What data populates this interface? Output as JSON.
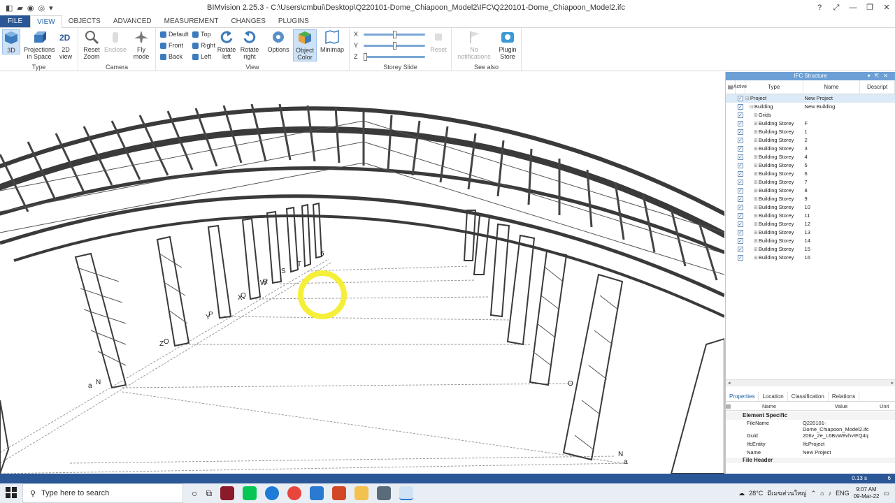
{
  "window": {
    "title": "BIMvision 2.25.3 - C:\\Users\\cmbui\\Desktop\\Q220101-Dome_Chiapoon_Model2\\IFC\\Q220101-Dome_Chiapoon_Model2.ifc",
    "help": "?"
  },
  "tabs": [
    "FILE",
    "VIEW",
    "OBJECTS",
    "ADVANCED",
    "MEASUREMENT",
    "CHANGES",
    "PLUGINS"
  ],
  "ribbon": {
    "type_group": {
      "label": "Type",
      "btn_3d": "3D",
      "btn_proj": "Projections in Space",
      "btn_2d": "2D view"
    },
    "camera_group": {
      "label": "Camera",
      "reset_zoom": "Reset Zoom",
      "enclose": "Enclose",
      "fly_mode": "Fly mode"
    },
    "view_group": {
      "label": "View",
      "default": "Default",
      "top": "Top",
      "front": "Front",
      "right": "Right",
      "back": "Back",
      "left": "Left",
      "rotate_left": "Rotate left",
      "rotate_right": "Rotate right",
      "options": "Options",
      "object_color": "Object Color",
      "minimap": "Minimap"
    },
    "storey_group": {
      "label": "Storey Slide",
      "x": "X",
      "y": "Y",
      "z": "Z",
      "reset": "Reset"
    },
    "see_also_group": {
      "label": "See also",
      "notifications": "No notifications",
      "plugin_store": "Plugin Store"
    }
  },
  "viewport": {
    "labels": [
      "6",
      "T",
      "S",
      "R",
      "Q",
      "P",
      "O",
      "N",
      "O",
      "N",
      "a",
      "Z",
      "Y",
      "X",
      "W",
      "a"
    ]
  },
  "ifc_structure": {
    "title": "IFC Structure",
    "columns": [
      "Active",
      "Type",
      "Name",
      "Descript"
    ],
    "rows": [
      {
        "type": "Project",
        "name": "New Project",
        "level": 0,
        "selected": true
      },
      {
        "type": "Building",
        "name": "New Building",
        "level": 1
      },
      {
        "type": "Grids",
        "name": "",
        "level": 2
      },
      {
        "type": "Building Storey",
        "name": "F",
        "level": 2
      },
      {
        "type": "Building Storey",
        "name": "1",
        "level": 2
      },
      {
        "type": "Building Storey",
        "name": "2",
        "level": 2
      },
      {
        "type": "Building Storey",
        "name": "3",
        "level": 2
      },
      {
        "type": "Building Storey",
        "name": "4",
        "level": 2
      },
      {
        "type": "Building Storey",
        "name": "5",
        "level": 2
      },
      {
        "type": "Building Storey",
        "name": "6",
        "level": 2
      },
      {
        "type": "Building Storey",
        "name": "7",
        "level": 2
      },
      {
        "type": "Building Storey",
        "name": "8",
        "level": 2
      },
      {
        "type": "Building Storey",
        "name": "9",
        "level": 2
      },
      {
        "type": "Building Storey",
        "name": "10",
        "level": 2
      },
      {
        "type": "Building Storey",
        "name": "11",
        "level": 2
      },
      {
        "type": "Building Storey",
        "name": "12",
        "level": 2
      },
      {
        "type": "Building Storey",
        "name": "13",
        "level": 2
      },
      {
        "type": "Building Storey",
        "name": "14",
        "level": 2
      },
      {
        "type": "Building Storey",
        "name": "15",
        "level": 2
      },
      {
        "type": "Building Storey",
        "name": "16",
        "level": 2
      }
    ]
  },
  "properties": {
    "tabs": [
      "Properties",
      "Location",
      "Classification",
      "Relations"
    ],
    "columns": [
      "Name",
      "Value",
      "Unit"
    ],
    "section": "Element Specific",
    "rows": [
      {
        "name": "FileName",
        "value": "Q220101-Dome_Chiapoon_Model2.ifc"
      },
      {
        "name": "Guid",
        "value": "206v_2e_L6BvW8vhvIFQ4q"
      },
      {
        "name": "IfcEntity",
        "value": "IfcProject"
      },
      {
        "name": "Name",
        "value": "New Project"
      }
    ],
    "next_section": "File Header"
  },
  "status": {
    "time": "0.13 s",
    "count": "6"
  },
  "taskbar": {
    "search_placeholder": "Type here to search",
    "weather": "28°C",
    "location": "มีเมฆส่วนใหญ่",
    "lang": "ENG",
    "time": "9:07 AM",
    "date": "09-Mar-22"
  },
  "colors": {
    "accent": "#2b5797",
    "panel_title": "#6c9fd5",
    "highlight": "#f5ef3a",
    "steel": "#3a3a3a"
  }
}
